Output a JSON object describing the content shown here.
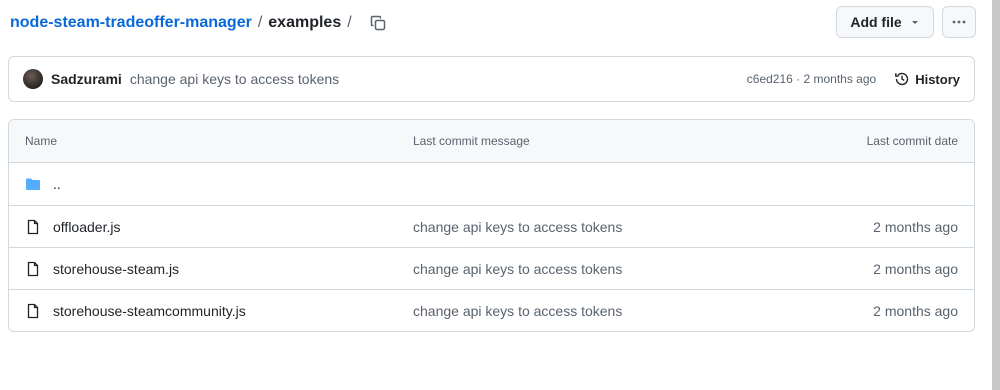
{
  "breadcrumb": {
    "repo": "node-steam-tradeoffer-manager",
    "separator": "/",
    "folder": "examples",
    "trailing_separator": "/"
  },
  "actions": {
    "add_file_label": "Add file",
    "more_icon": "kebab-horizontal-icon",
    "copy_icon": "copy-icon"
  },
  "latest_commit": {
    "author": "Sadzurami",
    "message": "change api keys to access tokens",
    "meta": "c6ed216 · 2 months ago",
    "history_label": "History"
  },
  "table": {
    "headers": {
      "name": "Name",
      "message": "Last commit message",
      "date": "Last commit date"
    },
    "parent_dir": "..",
    "rows": [
      {
        "name": "offloader.js",
        "message": "change api keys to access tokens",
        "date": "2 months ago",
        "icon": "file-icon"
      },
      {
        "name": "storehouse-steam.js",
        "message": "change api keys to access tokens",
        "date": "2 months ago",
        "icon": "file-icon"
      },
      {
        "name": "storehouse-steamcommunity.js",
        "message": "change api keys to access tokens",
        "date": "2 months ago",
        "icon": "file-icon"
      }
    ]
  },
  "colors": {
    "link": "#0969da",
    "border": "#d1d9e0",
    "muted": "#59636e",
    "folder": "#54aeff"
  }
}
